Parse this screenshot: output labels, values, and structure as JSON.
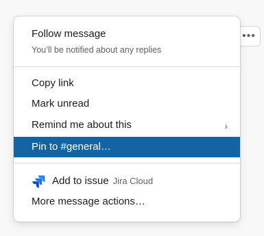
{
  "background": {
    "more_button_glyph": "•••"
  },
  "menu": {
    "follow": {
      "title": "Follow message",
      "subtitle": "You’ll be notified about any replies"
    },
    "items": [
      {
        "label": "Copy link"
      },
      {
        "label": "Mark unread"
      },
      {
        "label": "Remind me about this",
        "chevron": "›"
      },
      {
        "label": "Pin to #general…",
        "highlighted": true
      }
    ],
    "apps": [
      {
        "label": "Add to issue",
        "sublabel": "Jira Cloud",
        "icon": "jira-icon"
      },
      {
        "label": "More message actions…"
      }
    ],
    "colors": {
      "highlight": "#1264a3",
      "jira_blue": "#2684ff",
      "jira_dark": "#0052cc"
    }
  }
}
